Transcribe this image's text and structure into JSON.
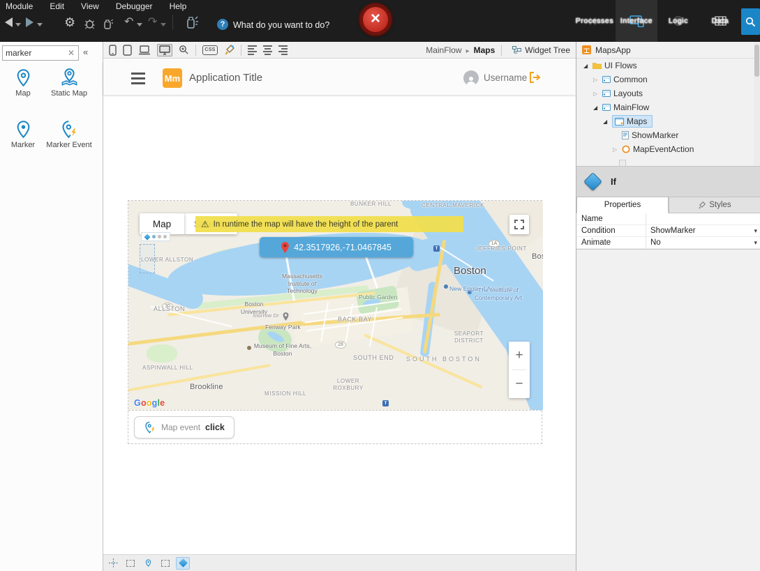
{
  "menubar": {
    "items": [
      "Module",
      "Edit",
      "View",
      "Debugger",
      "Help"
    ]
  },
  "toolbar": {
    "help_text": "What do you want to do?"
  },
  "nav_tabs": {
    "processes": "Processes",
    "interface": "Interface",
    "logic": "Logic",
    "data": "Data"
  },
  "left_panel": {
    "search_value": "marker",
    "toolbox": {
      "map": "Map",
      "static_map": "Static Map",
      "marker": "Marker",
      "marker_event": "Marker Event"
    }
  },
  "canvas_toolbar": {
    "css_badge": "CSS",
    "breadcrumb": {
      "parent": "MainFlow",
      "current": "Maps"
    },
    "widget_tree": "Widget Tree"
  },
  "preview": {
    "logo": "Mm",
    "title": "Application Title",
    "username": "Username"
  },
  "map": {
    "controls": {
      "map_btn": "Map",
      "satellite_btn": "Satellite",
      "zoom_in": "+",
      "zoom_out": "−"
    },
    "warning": "In runtime the map will have the height of the parent",
    "tooltip": "42.3517926,-71.0467845",
    "google_letters": [
      "G",
      "o",
      "o",
      "g",
      "l",
      "e"
    ],
    "google_colors": [
      "#4285F4",
      "#EA4335",
      "#FBBC05",
      "#4285F4",
      "#34A853",
      "#EA4335"
    ],
    "shields": {
      "s30": "30",
      "s28": "28",
      "s1a": "1A"
    },
    "transit_letter": "T",
    "labels": {
      "bunker_hill": "BUNKER HILL",
      "central_maverick": "CENTRAL MAVERICK",
      "jeffries_point": "JEFFRIES POINT",
      "lower_allston": "LOWER ALLSTON",
      "boston": "Boston",
      "bos_partial": "Bos",
      "aquarium": "New England Aquarium",
      "mit": "Massachusetts Institute of Technology",
      "allston": "ALLSTON",
      "bu": "Boston University",
      "public_garden": "Public Garden",
      "ica": "The Institute of Contemporary Art",
      "storrow": "Storrow Dr",
      "back_bay": "BACK BAY",
      "fenway": "Fenway Park",
      "seaport": "SEAPORT DISTRICT",
      "mfa": "Museum of Fine Arts, Boston",
      "south_end": "SOUTH END",
      "south_boston": "SOUTH BOSTON",
      "aspinwall": "ASPINWALL HILL",
      "brookline": "Brookline",
      "mission_hill": "MISSION HILL",
      "lower_roxbury": "LOWER ROXBURY"
    }
  },
  "map_event": {
    "label": "Map event",
    "action": "click"
  },
  "right_panel": {
    "module": "MapsApp",
    "tree": {
      "ui_flows": "UI Flows",
      "common": "Common",
      "layouts": "Layouts",
      "mainflow": "MainFlow",
      "maps": "Maps",
      "showmarker": "ShowMarker",
      "mapeventaction": "MapEventAction"
    },
    "selected_element": "If",
    "tabs": {
      "properties": "Properties",
      "styles": "Styles"
    },
    "props": {
      "name_label": "Name",
      "name_value": "",
      "condition_label": "Condition",
      "condition_value": "ShowMarker",
      "animate_label": "Animate",
      "animate_value": "No"
    }
  }
}
